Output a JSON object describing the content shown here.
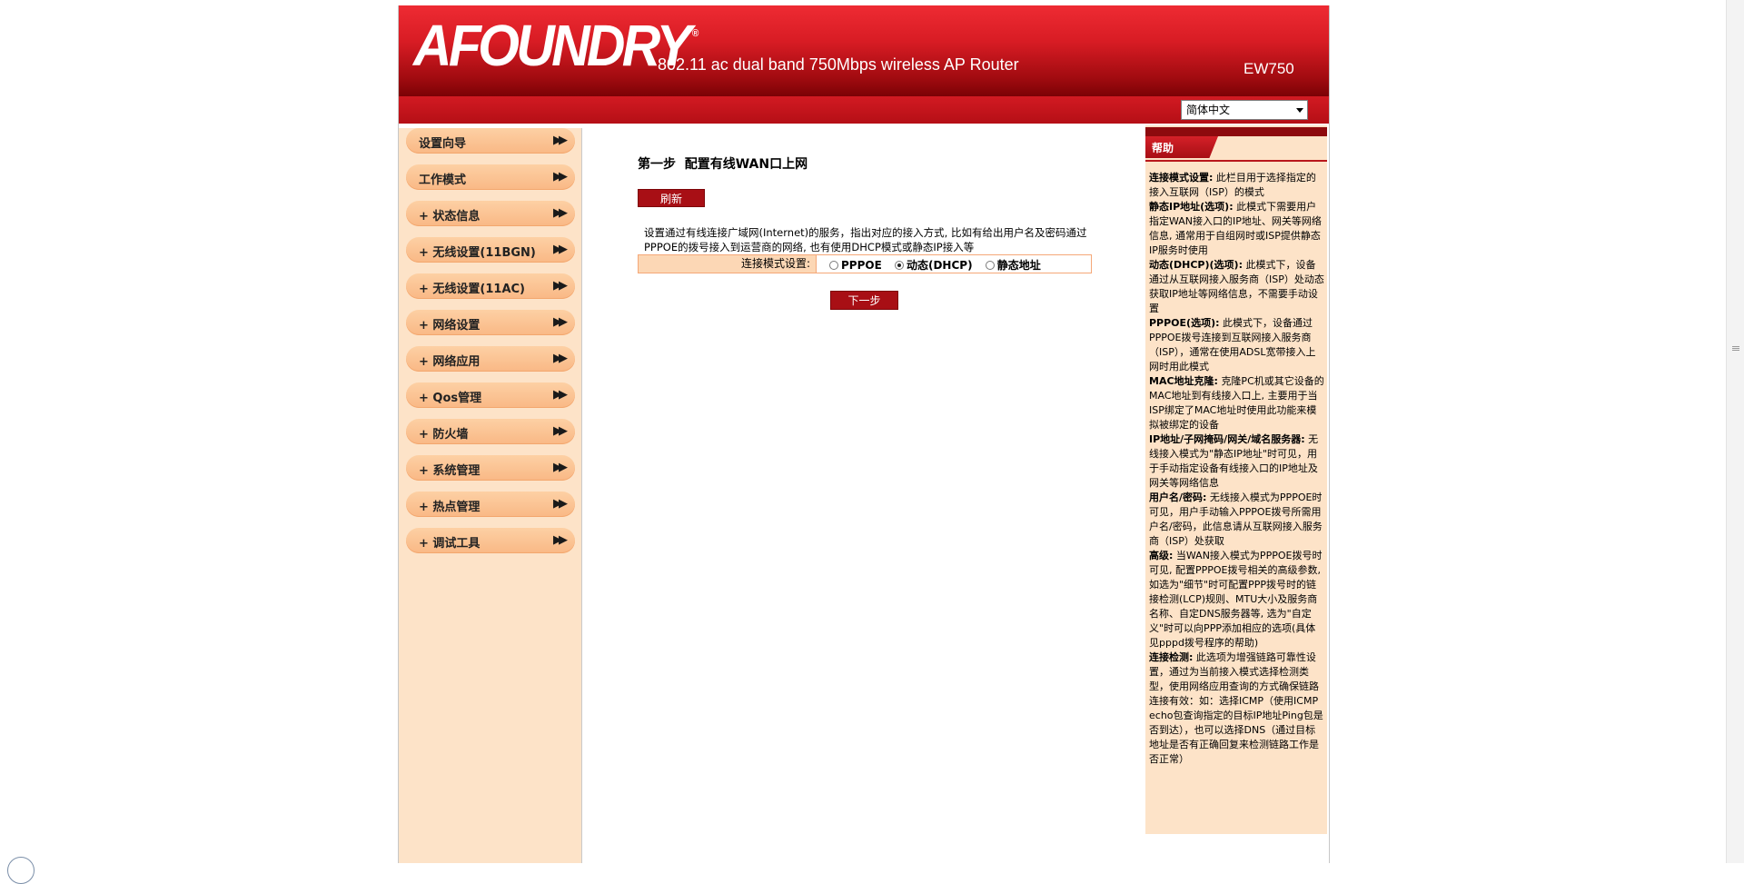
{
  "header": {
    "logo": "AFOUNDRY",
    "logo_mark": "®",
    "tagline": "802.11 ac dual band 750Mbps wireless AP Router",
    "model": "EW750",
    "language": "简体中文"
  },
  "sidebar": {
    "items": [
      {
        "label": "设置向导"
      },
      {
        "label": "工作模式"
      },
      {
        "label": "+ 状态信息"
      },
      {
        "label": "+ 无线设置(11BGN)"
      },
      {
        "label": "+ 无线设置(11AC)"
      },
      {
        "label": "+ 网络设置"
      },
      {
        "label": "+ 网络应用"
      },
      {
        "label": "+ Qos管理"
      },
      {
        "label": "+ 防火墙"
      },
      {
        "label": "+ 系统管理"
      },
      {
        "label": "+ 热点管理"
      },
      {
        "label": "+ 调试工具"
      }
    ],
    "chevron": "▶▶"
  },
  "main": {
    "title": "第一步  配置有线WAN口上网",
    "refresh_label": "刷新",
    "description": "设置通过有线连接广域网(Internet)的服务，指出对应的接入方式, 比如有给出用户名及密码通过PPPOE的拨号接入到运营商的网络, 也有使用DHCP模式或静态IP接入等",
    "connection_mode_label": "连接模式设置:",
    "options": [
      {
        "label": "PPPOE",
        "checked": false
      },
      {
        "label": "动态(DHCP)",
        "checked": true
      },
      {
        "label": "静态地址",
        "checked": false
      }
    ],
    "next_label": "下一步"
  },
  "help": {
    "title": "帮助",
    "sections": [
      {
        "term": "连接模式设置:",
        "text": "此栏目用于选择指定的接入互联网（ISP）的模式"
      },
      {
        "term": "静态IP地址(选项):",
        "text": "此模式下需要用户指定WAN接入口的IP地址、网关等网络信息, 通常用于自组网时或ISP提供静态IP服务时使用"
      },
      {
        "term": "动态(DHCP)(选项):",
        "text": "此模式下，设备通过从互联网接入服务商（ISP）处动态获取IP地址等网络信息，不需要手动设置"
      },
      {
        "term": "PPPOE(选项):",
        "text": "此模式下，设备通过PPPOE拨号连接到互联网接入服务商（ISP），通常在使用ADSL宽带接入上网时用此模式"
      },
      {
        "term": "MAC地址克隆:",
        "text": "克隆PC机或其它设备的MAC地址到有线接入口上, 主要用于当ISP绑定了MAC地址时使用此功能来模拟被绑定的设备"
      },
      {
        "term": "IP地址/子网掩码/网关/域名服务器:",
        "text": "无线接入模式为\"静态IP地址\"时可见，用于手动指定设备有线接入口的IP地址及网关等网络信息"
      },
      {
        "term": "用户名/密码:",
        "text": "无线接入模式为PPPOE时可见，用户手动输入PPPOE拨号所需用户名/密码，此信息请从互联网接入服务商（ISP）处获取"
      },
      {
        "term": "高级:",
        "text": "当WAN接入模式为PPPOE拨号时可见, 配置PPPOE拨号相关的高级参数, 如选为\"细节\"时可配置PPP拨号时的链接检测(LCP)规则、MTU大小及服务商名称、自定DNS服务器等, 选为\"自定义\"时可以向PPP添加相应的选项(具体见pppd拨号程序的帮助)"
      },
      {
        "term": "连接检测:",
        "text": "此选项为增强链路可靠性设置，通过为当前接入模式选择检测类型，使用网络应用查询的方式确保链路连接有效：如：选择ICMP（使用ICMP echo包查询指定的目标IP地址Ping包是否到达），也可以选择DNS（通过目标地址是否有正确回复来检测链路工作是否正常）"
      }
    ]
  }
}
